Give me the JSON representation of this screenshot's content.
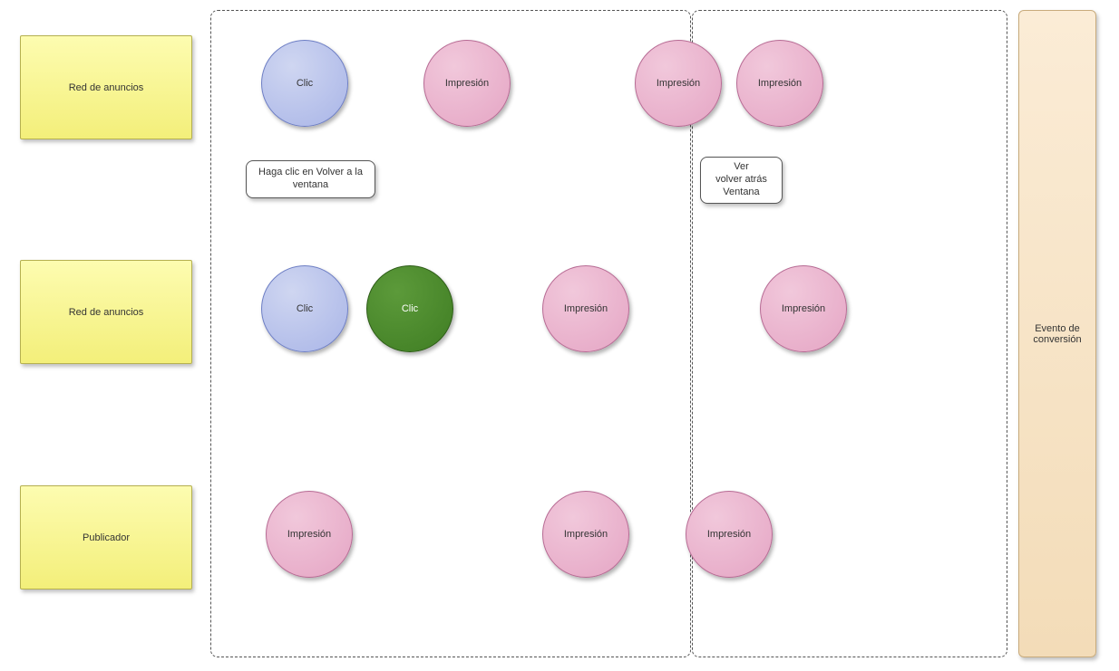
{
  "leftBoxes": {
    "top": "Red de anuncios",
    "middle": "Red de anuncios",
    "bottom": "Publicador"
  },
  "notes": {
    "clickBack": "Haga clic en Volver a la ventana",
    "viewBack": "Ver\nvolver atrás\nVentana"
  },
  "labels": {
    "clic": "Clic",
    "impresion": "Impresión"
  },
  "conversion": "Evento de conversión"
}
